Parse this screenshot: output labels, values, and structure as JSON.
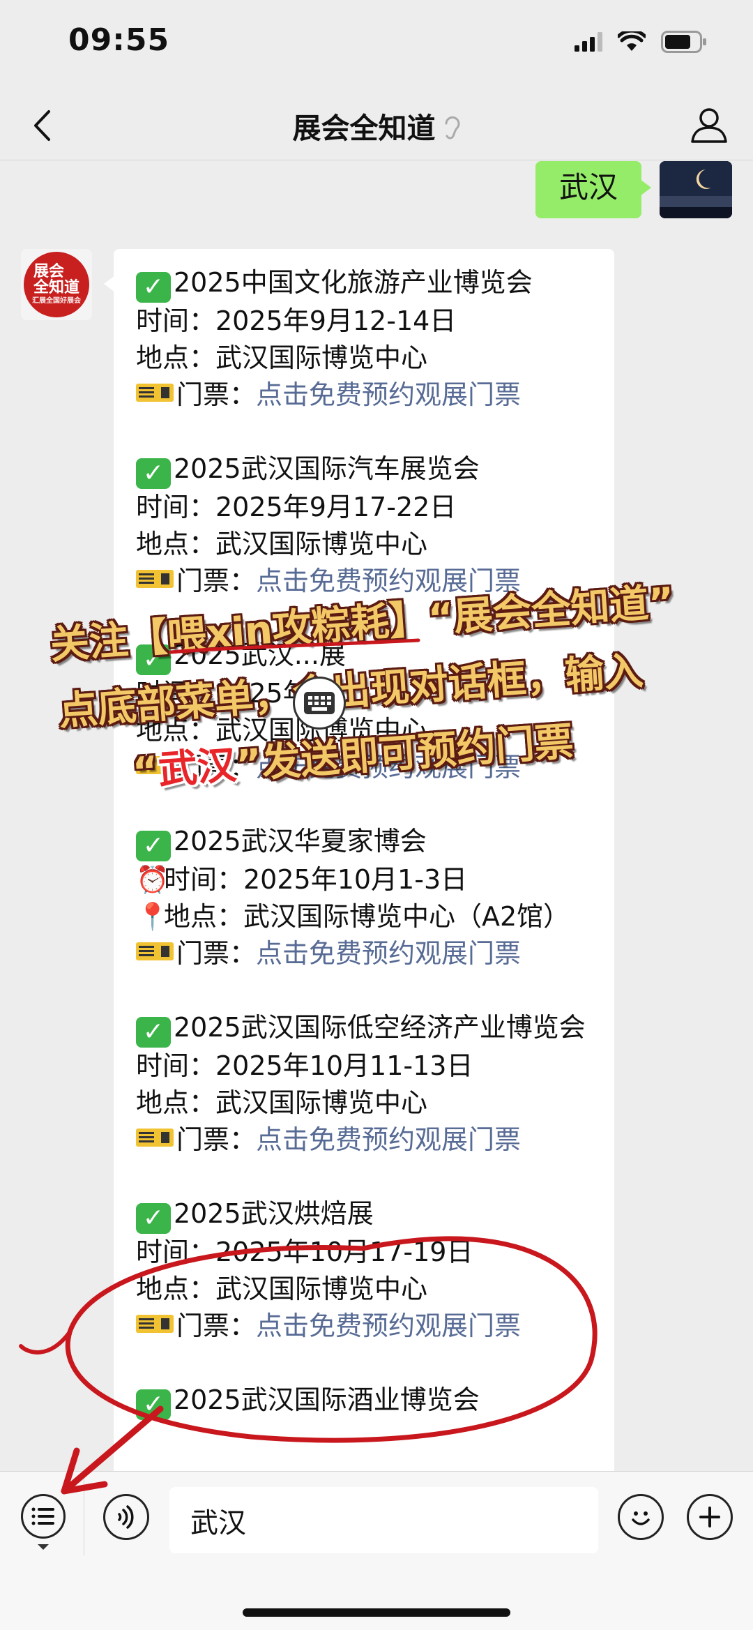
{
  "status_bar": {
    "time": "09:55"
  },
  "nav": {
    "title": "展会全知道"
  },
  "chat": {
    "user_message": "武汉",
    "bot_avatar_text": "展会\n全知道",
    "bot_avatar_sub": "汇展全国好展会",
    "events": [
      {
        "name": "2025中国文化旅游产业博览会",
        "time": "时间：2025年9月12-14日",
        "place": "地点：武汉国际博览中心",
        "ticket_label": "门票：",
        "ticket_link": "点击免费预约观展门票"
      },
      {
        "name": "2025武汉国际汽车展览会",
        "time": "时间：2025年9月17-22日",
        "place": "地点：武汉国际博览中心",
        "ticket_label": "门票：",
        "ticket_link": "点击免费预约观展门票"
      },
      {
        "name": "2025武汉...展",
        "time": "时间：2025年10...",
        "place": "地点：武汉国际博览中心",
        "ticket_label": "门票：",
        "ticket_link": "点击免费预约观展门票"
      },
      {
        "name": "2025武汉华夏家博会",
        "time": "时间：2025年10月1-3日",
        "place": "地点：武汉国际博览中心（A2馆）",
        "ticket_label": "门票：",
        "ticket_link": "点击免费预约观展门票"
      },
      {
        "name": "2025武汉国际低空经济产业博览会",
        "time": "时间：2025年10月11-13日",
        "place": "地点：武汉国际博览中心",
        "ticket_label": "门票：",
        "ticket_link": "点击免费预约观展门票"
      },
      {
        "name": "2025武汉烘焙展",
        "time": "时间：2025年10月17-19日",
        "place": "地点：武汉国际博览中心",
        "ticket_label": "门票：",
        "ticket_link": "点击免费预约观展门票"
      },
      {
        "name": "2025武汉国际酒业博览会",
        "time": "",
        "place": "",
        "ticket_label": "",
        "ticket_link": ""
      }
    ]
  },
  "overlay": {
    "line1_a": "关注【喂xin攻粽耗】“展会全知道”",
    "line2": "点底部菜单，会出现对话框，输入",
    "line3_open": "“",
    "line3_red": "武汉",
    "line3_close": "”发送即可预约门票"
  },
  "input_bar": {
    "input_value": "武汉"
  },
  "colors": {
    "link": "#576b95",
    "bubble_green": "#95ec69",
    "annotation_red": "#c8181e"
  }
}
